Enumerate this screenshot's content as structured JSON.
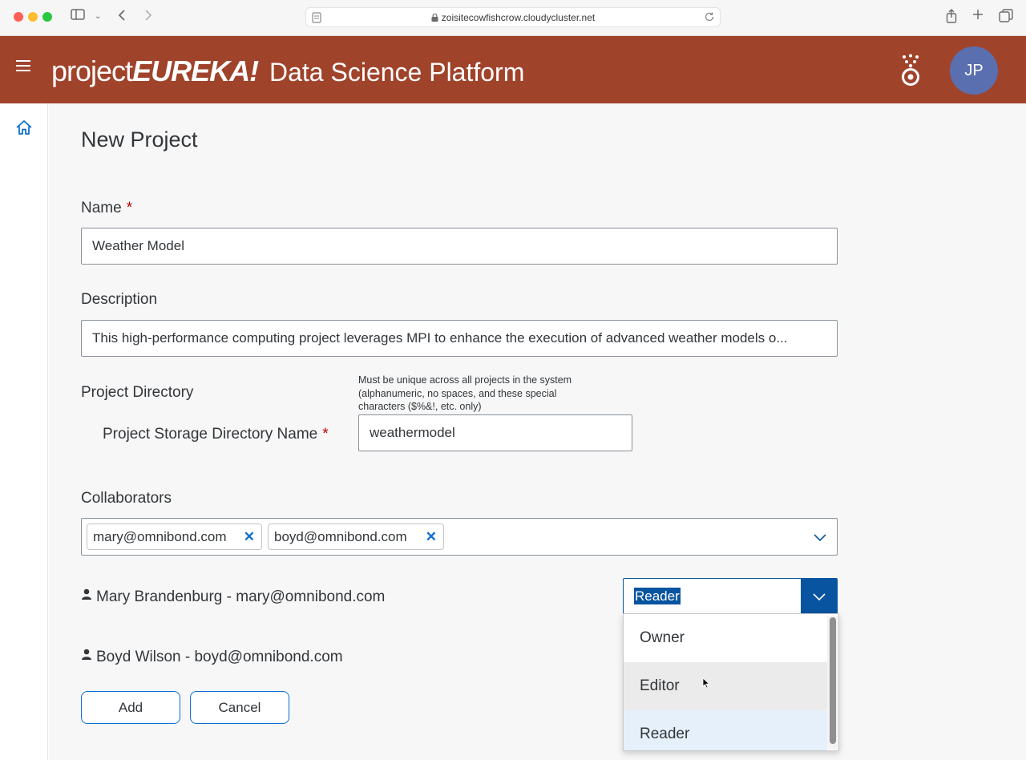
{
  "browser": {
    "url": "zoisitecowfishcrow.cloudycluster.net"
  },
  "header": {
    "logo_part1": "project",
    "logo_part2": "EUREKA!",
    "title": "Data Science Platform",
    "avatar_initials": "JP",
    "brand_color": "#a0432b"
  },
  "form": {
    "title": "New Project",
    "name_label": "Name",
    "required_mark": "*",
    "name_value": "Weather Model",
    "description_label": "Description",
    "description_value": "This high-performance computing project leverages MPI to enhance the execution of advanced weather models o...",
    "project_directory_label": "Project Directory",
    "storage_dir_label": "Project Storage Directory Name",
    "storage_dir_hint": "Must be unique across all projects in the system (alphanumeric, no spaces, and these special characters ($%&!, etc. only)",
    "storage_dir_value": "weathermodel",
    "collaborators_label": "Collaborators",
    "collaborator_tokens": [
      "mary@omnibond.com",
      "boyd@omnibond.com"
    ],
    "token_remove_glyph": "✕",
    "people": [
      {
        "text": "Mary Brandenburg - mary@omnibond.com"
      },
      {
        "text": "Boyd Wilson - boyd@omnibond.com"
      }
    ],
    "role_selected": "Reader",
    "role_options": [
      "Owner",
      "Editor",
      "Reader"
    ],
    "add_label": "Add",
    "cancel_label": "Cancel"
  },
  "icons": {
    "menu": "hamburger-icon",
    "home": "home-icon",
    "mascot": "eureka-mascot-icon",
    "person": "person-icon",
    "chevron": "chevron-down-icon"
  },
  "colors": {
    "accent": "#0854a0",
    "link": "#0a6ed1",
    "required": "#bb0000"
  }
}
